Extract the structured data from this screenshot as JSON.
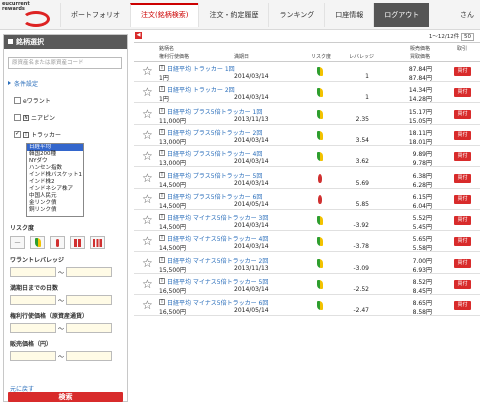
{
  "header": {
    "brand_lines": [
      "eucurrent",
      "rewards"
    ],
    "nav": [
      "ポートフォリオ",
      "注文(銘柄検索)",
      "注文・約定履歴",
      "ランキング",
      "口座情報",
      "ログアウト"
    ],
    "user": "さん"
  },
  "sidebar": {
    "title": "銘柄選択",
    "search_placeholder": "原資産名または原資産コード",
    "cond_link": "条件設定",
    "warrant": "eワラント",
    "neoapin": "ニアピン",
    "tracker": "トラッカー",
    "listbox": [
      "日経平均",
      "韓国200種",
      "NYダウ",
      "ハンセン指数",
      "インド株バスケット1",
      "インド株2",
      "インドネシア株ア",
      "中国人民元",
      "金リンク債",
      "銅リンク債"
    ],
    "risk_label": "リスク度",
    "warrant_leverage": "ワラントレバレッジ",
    "days_to_expiry": "満期日までの日数",
    "rights_price": "権利行使価格（原資産通貨）",
    "sell_price": "販売価格（円）",
    "range_sep": "～",
    "restore": "元に戻す",
    "search_button": "検索",
    "risk_icons": [
      "—",
      "leaf",
      "🌶",
      "🌶🌶",
      "🌶🌶🌶"
    ]
  },
  "main": {
    "collapse": "◀",
    "pager": "1〜12/12件",
    "pager_select": "50",
    "headers": {
      "name": "銘柄名",
      "rights": "権利行使価格",
      "expiry": "満期日",
      "risk": "リスク度",
      "lev": "レバレッジ",
      "ask": "販売価格",
      "bid": "買取価格",
      "trade": "取引"
    },
    "buy_label": "買付",
    "rows": [
      {
        "name": "日経平均 トラッカー 1回",
        "price": "1円",
        "date": "2014/03/14",
        "risk": "leaf",
        "lev": "1",
        "ask": "87.84円",
        "bid": "87.84円"
      },
      {
        "name": "日経平均 トラッカー 2回",
        "price": "1円",
        "date": "2014/03/14",
        "risk": "leaf",
        "lev": "1",
        "ask": "14.34円",
        "bid": "14.28円"
      },
      {
        "name": "日経平均 プラス5倍トラッカー 1回",
        "price": "11,000円",
        "date": "2013/11/13",
        "risk": "leaf",
        "lev": "2.35",
        "ask": "15.17円",
        "bid": "15.05円"
      },
      {
        "name": "日経平均 プラス5倍トラッカー 2回",
        "price": "13,000円",
        "date": "2014/03/14",
        "risk": "leaf",
        "lev": "3.54",
        "ask": "18.11円",
        "bid": "18.01円"
      },
      {
        "name": "日経平均 プラス5倍トラッカー 4回",
        "price": "13,000円",
        "date": "2014/03/14",
        "risk": "leaf",
        "lev": "3.62",
        "ask": "9.89円",
        "bid": "9.78円"
      },
      {
        "name": "日経平均 プラス5倍トラッカー 5回",
        "price": "14,500円",
        "date": "2014/03/14",
        "risk": "fire",
        "lev": "5.69",
        "ask": "6.38円",
        "bid": "6.28円"
      },
      {
        "name": "日経平均 プラス5倍トラッカー 6回",
        "price": "14,500円",
        "date": "2014/05/14",
        "risk": "fire",
        "lev": "5.85",
        "ask": "6.15円",
        "bid": "6.04円"
      },
      {
        "name": "日経平均 マイナス5倍トラッカー 3回",
        "price": "14,500円",
        "date": "2014/03/14",
        "risk": "leaf",
        "lev": "-3.92",
        "ask": "5.52円",
        "bid": "5.45円"
      },
      {
        "name": "日経平均 マイナス5倍トラッカー 4回",
        "price": "14,500円",
        "date": "2014/03/14",
        "risk": "leaf",
        "lev": "-3.78",
        "ask": "5.65円",
        "bid": "5.58円"
      },
      {
        "name": "日経平均 マイナス5倍トラッカー 2回",
        "price": "15,500円",
        "date": "2013/11/13",
        "risk": "leaf",
        "lev": "-3.09",
        "ask": "7.00円",
        "bid": "6.93円"
      },
      {
        "name": "日経平均 マイナス5倍トラッカー 5回",
        "price": "16,500円",
        "date": "2014/03/14",
        "risk": "leaf",
        "lev": "-2.52",
        "ask": "8.52円",
        "bid": "8.45円"
      },
      {
        "name": "日経平均 マイナス5倍トラッカー 6回",
        "price": "16,500円",
        "date": "2014/05/14",
        "risk": "leaf",
        "lev": "-2.47",
        "ask": "8.65円",
        "bid": "8.58円"
      }
    ]
  }
}
